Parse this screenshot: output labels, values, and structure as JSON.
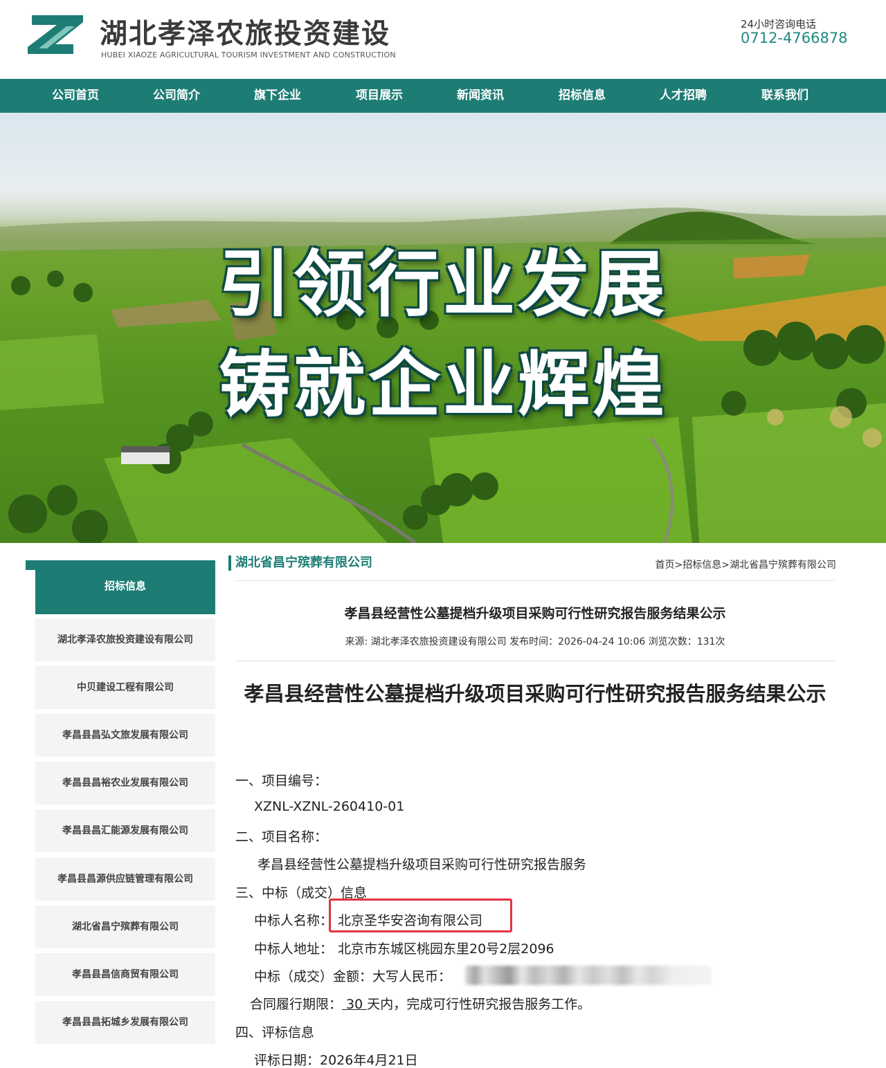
{
  "header": {
    "logo_title": "湖北孝泽农旅投资建设",
    "logo_subtitle": "HUBEI XIAOZE AGRICULTURAL TOURISM INVESTMENT AND CONSTRUCTION",
    "hotline_label": "24小时咨询电话",
    "hotline_number": "0712-4766878",
    "brand_color": "#1d7d75"
  },
  "nav": {
    "items": [
      "公司首页",
      "公司简介",
      "旗下企业",
      "项目展示",
      "新闻资讯",
      "招标信息",
      "人才招聘",
      "联系我们"
    ]
  },
  "banner": {
    "line1": "引领行业发展",
    "line2": "铸就企业辉煌"
  },
  "sidebar": {
    "heading": "招标信息",
    "items": [
      "湖北孝泽农旅投资建设有限公司",
      "中贝建设工程有限公司",
      "孝昌县昌弘文旅发展有限公司",
      "孝昌县昌裕农业发展有限公司",
      "孝昌县昌汇能源发展有限公司",
      "孝昌县昌源供应链管理有限公司",
      "湖北省昌宁殡葬有限公司",
      "孝昌县昌信商贸有限公司",
      "孝昌县昌拓城乡发展有限公司"
    ]
  },
  "section": {
    "title": "湖北省昌宁殡葬有限公司",
    "breadcrumb": [
      "首页",
      ">",
      "招标信息",
      ">",
      "湖北省昌宁殡葬有限公司"
    ]
  },
  "article": {
    "title": "孝昌县经营性公墓提档升级项目采购可行性研究报告服务结果公示",
    "meta": "来源: 湖北孝泽农旅投资建设有限公司   发布时间：2026-04-24 10:06   浏览次数：131次",
    "doc_title": "孝昌县经营性公墓提档升级项目采购可行性研究报告服务结果公示",
    "s1_heading": "一、项目编号：",
    "s1_value": "XZNL-XZNL-260410-01",
    "s2_heading": "二、项目名称：",
    "s2_value": "孝昌县经营性公墓提档升级项目采购可行性研究报告服务",
    "s3_heading": "三、中标（成交）信息",
    "winner_label": "中标人名称：",
    "winner_name": "北京圣华安咨询有限公司",
    "address_label": "中标人地址：",
    "address_value": "北京市东城区桃园东里20号2层2096",
    "amount_label": "中标（成交）金额：大写人民币：",
    "period_label": "合同履行期限：",
    "period_days": " 30 ",
    "period_rest": "天内，完成可行性研究报告服务工作。",
    "s4_heading": "四、评标信息",
    "review_date": "评标日期：2026年4月21日"
  }
}
